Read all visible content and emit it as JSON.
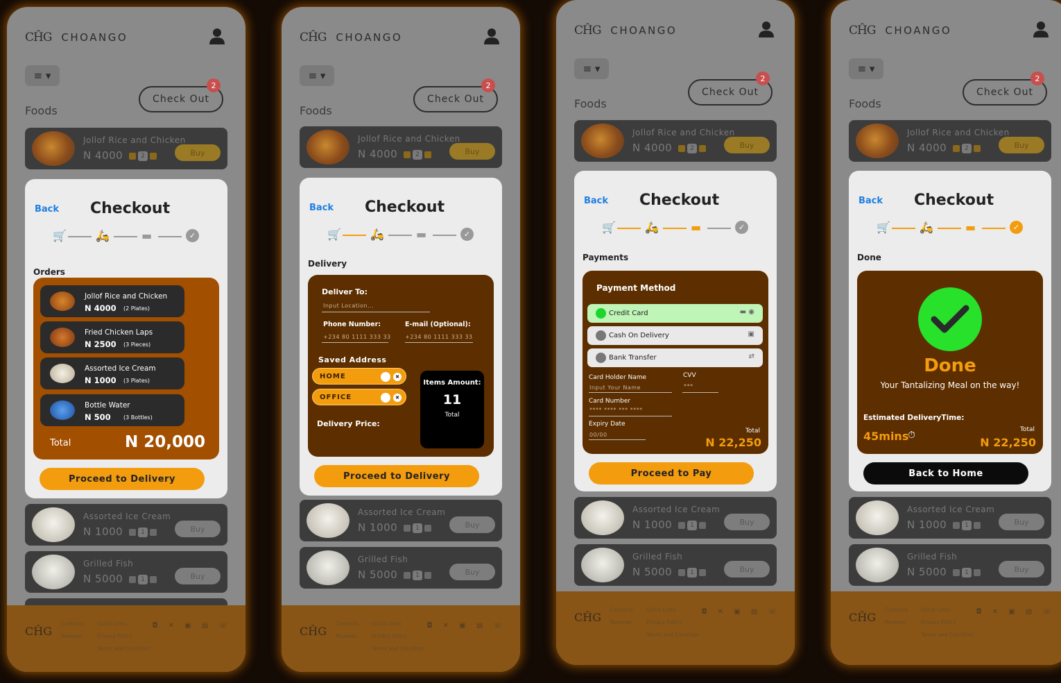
{
  "app": {
    "logo_mark": "CĤG",
    "name": "CHOANGO",
    "check_out": "Check Out",
    "cart_count": "2",
    "foods_heading": "Foods"
  },
  "foods": [
    {
      "name": "Jollof Rice and Chicken",
      "price": "N 4000",
      "qty": "2",
      "buy": "Buy"
    },
    {
      "name": "Assorted Ice Cream",
      "price": "N 1000",
      "qty": "1",
      "buy": "Buy"
    },
    {
      "name": "Grilled Fish",
      "price": "N 5000",
      "qty": "1",
      "buy": "Buy"
    }
  ],
  "footer": {
    "contacts": "Contacts",
    "quick_links": "Quick Links",
    "reviews": "Reviews",
    "privacy": "Privacy Policy",
    "terms": "Terms and Condition"
  },
  "modal": {
    "back": "Back",
    "title": "Checkout"
  },
  "orders_screen": {
    "section": "Orders",
    "items": [
      {
        "name": "Jollof Rice and Chicken",
        "price": "N 4000",
        "unit": "(2 Plates)"
      },
      {
        "name": "Fried Chicken Laps",
        "price": "N 2500",
        "unit": "(3 Pieces)"
      },
      {
        "name": "Assorted Ice Cream",
        "price": "N 1000",
        "unit": "(3 Plates)"
      },
      {
        "name": "Bottle Water",
        "price": "N 500",
        "unit": "(3 Bottles)"
      }
    ],
    "total_label": "Total",
    "total": "N 20,000",
    "cta": "Proceed to Delivery"
  },
  "delivery_screen": {
    "section": "Delivery",
    "deliver_to": "Deliver To:",
    "location_placeholder": "Input Location...",
    "phone_label": "Phone Number:",
    "phone_value": "+234 80 1111 333 33",
    "email_label": "E-mail (Optional):",
    "email_value": "+234 80 1111 333 33",
    "saved_address": "Saved Address",
    "addresses": [
      "HOME",
      "OFFICE"
    ],
    "delivery_price": "Delivery Price:",
    "items_amount_label": "Items Amount:",
    "items_amount": "11",
    "total_label": "Total",
    "cta": "Proceed to Delivery"
  },
  "payment_screen": {
    "section": "Payments",
    "method_title": "Payment Method",
    "methods": [
      "Credit Card",
      "Cash On Delivery",
      "Bank Transfer"
    ],
    "card_holder": "Card Holder Name",
    "card_holder_placeholder": "Input Your Name",
    "cvv": "CVV",
    "cvv_placeholder": "***",
    "card_number": "Card Number",
    "card_number_placeholder": "**** **** *** ****",
    "expiry": "Expiry Date",
    "expiry_placeholder": "00/00",
    "total_label": "Total",
    "total": "N 22,250",
    "cta": "Proceed to Pay"
  },
  "done_screen": {
    "section": "Done",
    "title": "Done",
    "subtitle": "Your Tantalizing Meal on the way!",
    "eta_label": "Estimated DeliveryTime:",
    "eta": "45mins",
    "total_label": "Total",
    "total": "N 22,250",
    "cta": "Back to Home"
  },
  "colors": {
    "accent": "#f39c0e",
    "link": "#1f7fe0",
    "success": "#27e12a",
    "panel_orange": "#a24f00",
    "panel_brown": "#5c2e00"
  }
}
